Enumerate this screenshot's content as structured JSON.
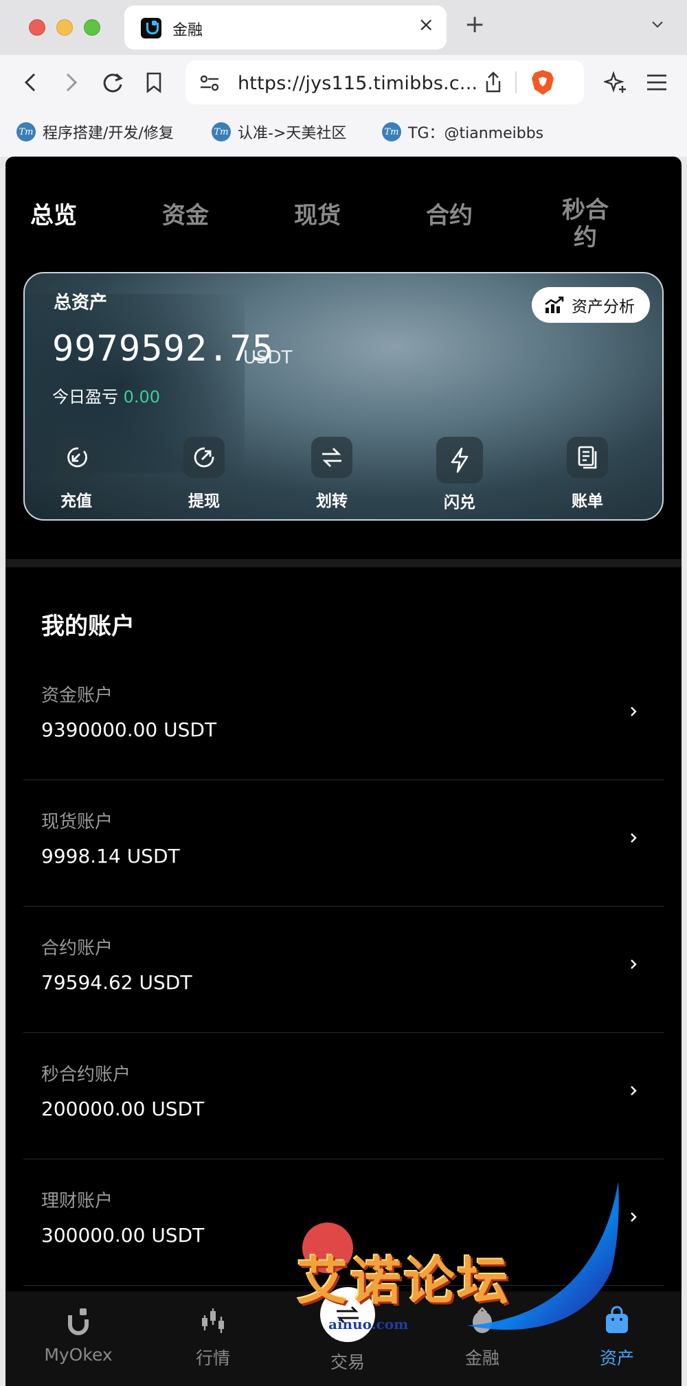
{
  "browser": {
    "tab_title": "金融",
    "url": "https://jys115.timibbs.c...",
    "bookmarks": [
      {
        "label": "程序搭建/开发/修复"
      },
      {
        "label": "认准->天美社区"
      },
      {
        "label": "TG：@tianmeibbs"
      }
    ],
    "bookmark_icon_text": "Tm"
  },
  "top_tabs": [
    "总览",
    "资金",
    "现货",
    "合约",
    "秒合约"
  ],
  "top_tabs_split": {
    "wrap_line1": "秒合",
    "wrap_line2": "约"
  },
  "asset_card": {
    "title": "总资产",
    "analysis_label": "资产分析",
    "amount": "9979592.75",
    "unit": "USDT",
    "pnl_label": "今日盈亏",
    "pnl_value": "0.00",
    "actions": [
      {
        "label": "充值",
        "icon": "deposit-icon"
      },
      {
        "label": "提现",
        "icon": "withdraw-icon"
      },
      {
        "label": "划转",
        "icon": "transfer-icon"
      },
      {
        "label": "闪兑",
        "icon": "flash-exchange-icon"
      },
      {
        "label": "账单",
        "icon": "bill-icon"
      }
    ]
  },
  "accounts": {
    "title": "我的账户",
    "items": [
      {
        "name": "资金账户",
        "balance": "9390000.00 USDT"
      },
      {
        "name": "现货账户",
        "balance": "9998.14 USDT"
      },
      {
        "name": "合约账户",
        "balance": "79594.62 USDT"
      },
      {
        "name": "秒合约账户",
        "balance": "200000.00 USDT"
      },
      {
        "name": "理财账户",
        "balance": "300000.00 USDT"
      }
    ]
  },
  "bottom_nav": [
    {
      "label": "MyOkex",
      "icon": "home-logo-icon"
    },
    {
      "label": "行情",
      "icon": "market-icon"
    },
    {
      "label": "交易",
      "icon": "trade-icon"
    },
    {
      "label": "金融",
      "icon": "finance-icon"
    },
    {
      "label": "资产",
      "icon": "assets-icon"
    }
  ],
  "watermark": {
    "text": "艾诺论坛",
    "url": "ainuo.com"
  },
  "colors": {
    "accent": "#4aa3f7",
    "pnl": "#3fcf95",
    "background": "#000000"
  }
}
